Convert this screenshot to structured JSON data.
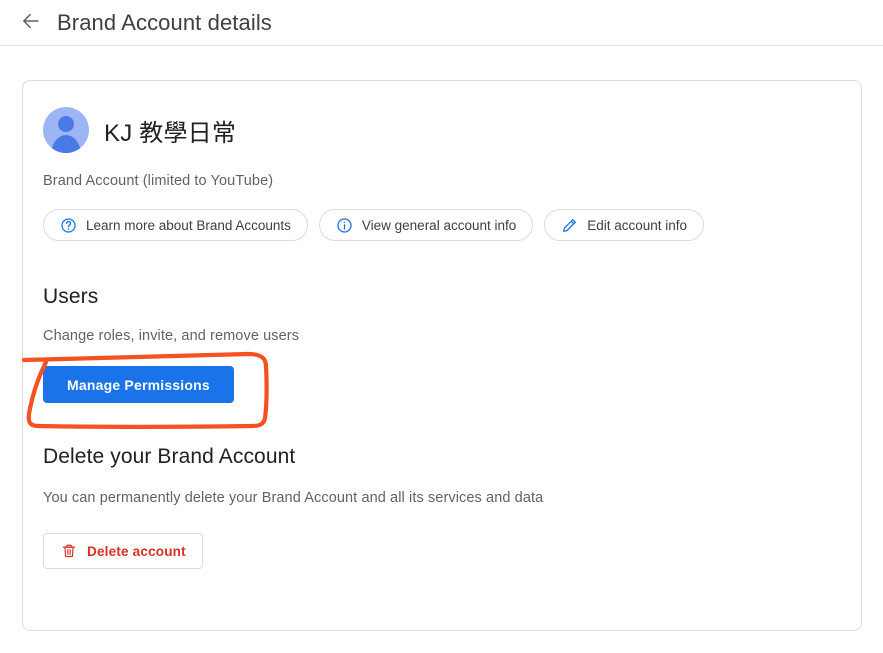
{
  "header": {
    "back_icon": "arrow-left-icon",
    "title": "Brand Account details"
  },
  "account": {
    "avatar_icon": "person-avatar-icon",
    "name": "KJ 教學日常",
    "subtitle": "Brand Account (limited to YouTube)",
    "chips": [
      {
        "icon": "help-circle-icon",
        "label": "Learn more about Brand Accounts"
      },
      {
        "icon": "info-circle-icon",
        "label": "View general account info"
      },
      {
        "icon": "pencil-edit-icon",
        "label": "Edit account info"
      }
    ]
  },
  "users": {
    "title": "Users",
    "description": "Change roles, invite, and remove users",
    "button_label": "Manage Permissions"
  },
  "delete": {
    "title": "Delete your Brand Account",
    "description": "You can permanently delete your Brand Account and all its services and data",
    "button_icon": "trash-icon",
    "button_label": "Delete account"
  },
  "annotation": {
    "type": "hand-drawn-rectangle",
    "target": "Manage Permissions",
    "color": "#f4511e"
  },
  "colors": {
    "accent_blue": "#1a73e8",
    "icon_blue": "#1a73e8",
    "danger_red": "#d93025",
    "text_primary": "#202124",
    "text_secondary": "#5f6368",
    "border": "#dadce0",
    "annotation_orange": "#f4511e"
  }
}
